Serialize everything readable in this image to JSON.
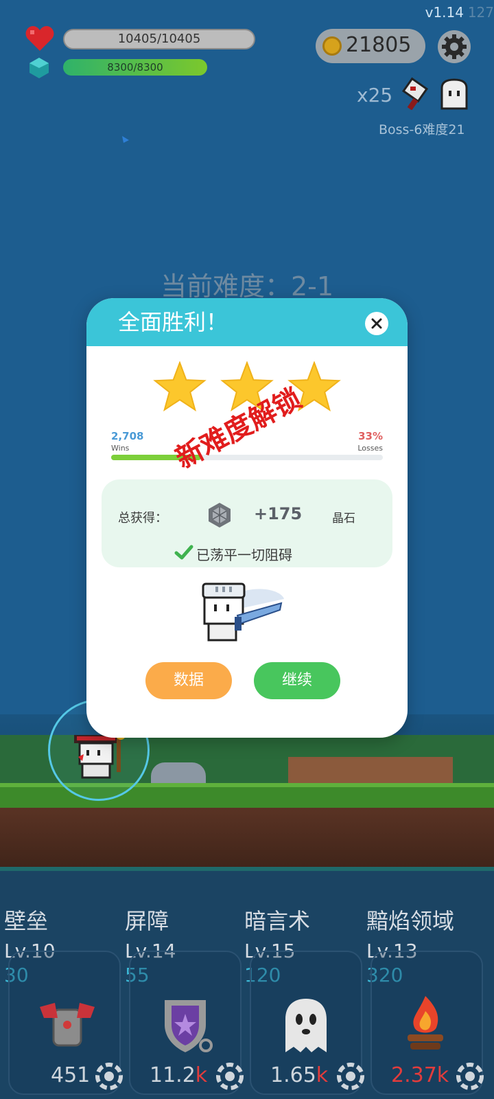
{
  "hud": {
    "version": "v1.14",
    "version_ghost": "127",
    "hp_text": "10405/10405",
    "mp_text": "8300/8300",
    "coins": "21805",
    "boss_count": "x25",
    "boss_label": "Boss-6难度21"
  },
  "difficulty_text": "当前难度：2-1",
  "modal": {
    "title": "全面胜利！",
    "stars_earned": 3,
    "stars_total": 3,
    "wins_value": "2,708",
    "wins_label": "Wins",
    "losses_value": "33%",
    "losses_label": "Losses",
    "progress_fraction": 0.33,
    "unlock_stamp": "新难度解锁",
    "reward_label": "总获得：",
    "reward_value": "+175",
    "reward_unit": "晶石",
    "clear_text": "已荡平一切阻碍",
    "btn_data": "数据",
    "btn_continue": "继续"
  },
  "skills": [
    {
      "name": "壁垒",
      "level": "Lv.10",
      "cost": "30",
      "power_num": "451",
      "power_unit": ""
    },
    {
      "name": "屏障",
      "level": "Lv.14",
      "cost": "55",
      "power_num": "11.2",
      "power_unit": "k"
    },
    {
      "name": "暗言术",
      "level": "Lv.15",
      "cost": "120",
      "power_num": "1.65",
      "power_unit": "k"
    },
    {
      "name": "黯焰领域",
      "level": "Lv.13",
      "cost": "320",
      "power_num": "2.37",
      "power_unit": "k"
    }
  ],
  "colors": {
    "modal_header": "#3bc5d8",
    "btn_data": "#fbab4a",
    "btn_continue": "#48c65d",
    "stamp": "#e11d1d",
    "progress_fill": "#7ccf3a"
  }
}
